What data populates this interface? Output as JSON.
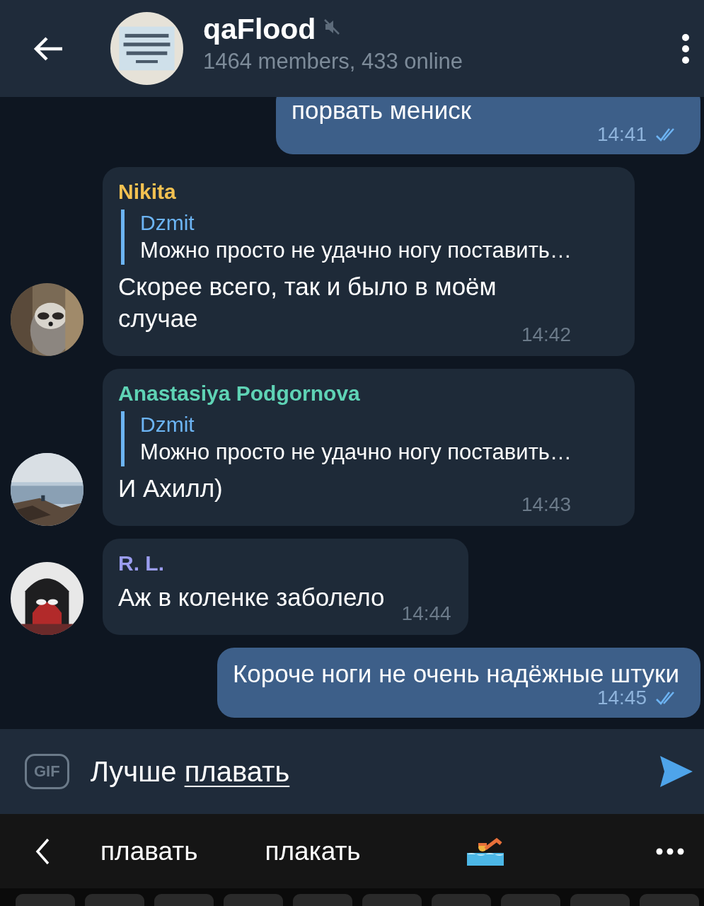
{
  "header": {
    "title": "qaFlood",
    "muted": true,
    "subtitle": "1464 members, 433 online"
  },
  "messages": [
    {
      "kind": "outgoing",
      "text": "порвать мениск",
      "time": "14:41",
      "read": true
    },
    {
      "kind": "incoming",
      "sender": "Nikita",
      "color": "#f3c151",
      "reply": {
        "author": "Dzmit",
        "text": "Можно просто не удачно ногу поставить…"
      },
      "text": "Скорее всего, так и было в моём случае",
      "time": "14:42"
    },
    {
      "kind": "incoming",
      "sender": "Anastasiya Podgornova",
      "color": "#5fd3b5",
      "reply": {
        "author": "Dzmit",
        "text": "Можно просто не удачно ногу поставить…"
      },
      "text": "И Ахилл)",
      "time": "14:43"
    },
    {
      "kind": "incoming",
      "sender": "R. L.",
      "color": "#9b9df0",
      "text": "Аж в коленке заболело",
      "time": "14:44"
    },
    {
      "kind": "outgoing",
      "text": "Короче ноги не очень надёжные штуки",
      "time": "14:45",
      "read": true
    }
  ],
  "composer": {
    "gif_label": "GIF",
    "text": "Лучше",
    "composing_word": "плавать"
  },
  "suggestions": [
    "плавать",
    "плакать"
  ]
}
